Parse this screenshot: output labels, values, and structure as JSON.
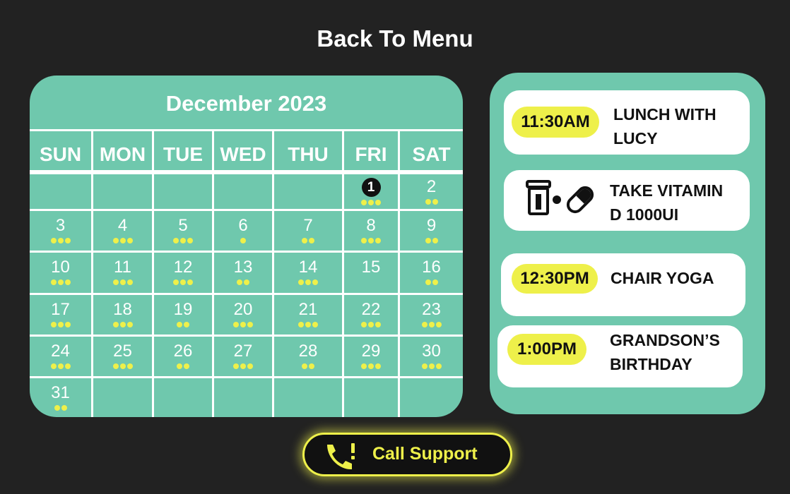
{
  "header": {
    "back_label": "Back To Menu"
  },
  "calendar": {
    "title": "December 2023",
    "weekdays": [
      "SUN",
      "MON",
      "TUE",
      "WED",
      "THU",
      "FRI",
      "SAT"
    ],
    "days": [
      {
        "n": "1",
        "dots": 3,
        "today": true
      },
      {
        "n": "2",
        "dots": 2
      },
      {
        "n": "3",
        "dots": 3
      },
      {
        "n": "4",
        "dots": 3
      },
      {
        "n": "5",
        "dots": 3
      },
      {
        "n": "6",
        "dots": 1
      },
      {
        "n": "7",
        "dots": 2
      },
      {
        "n": "8",
        "dots": 3
      },
      {
        "n": "9",
        "dots": 2
      },
      {
        "n": "10",
        "dots": 3
      },
      {
        "n": "11",
        "dots": 3
      },
      {
        "n": "12",
        "dots": 3
      },
      {
        "n": "13",
        "dots": 2
      },
      {
        "n": "14",
        "dots": 3
      },
      {
        "n": "15",
        "dots": 0
      },
      {
        "n": "16",
        "dots": 2
      },
      {
        "n": "17",
        "dots": 3
      },
      {
        "n": "18",
        "dots": 3
      },
      {
        "n": "19",
        "dots": 2
      },
      {
        "n": "20",
        "dots": 3
      },
      {
        "n": "21",
        "dots": 3
      },
      {
        "n": "22",
        "dots": 3
      },
      {
        "n": "23",
        "dots": 3
      },
      {
        "n": "24",
        "dots": 3
      },
      {
        "n": "25",
        "dots": 3
      },
      {
        "n": "26",
        "dots": 2
      },
      {
        "n": "27",
        "dots": 3
      },
      {
        "n": "28",
        "dots": 2
      },
      {
        "n": "29",
        "dots": 3
      },
      {
        "n": "30",
        "dots": 3
      },
      {
        "n": "31",
        "dots": 2
      }
    ]
  },
  "events": [
    {
      "time": "11:30AM",
      "title_line1": "LUNCH WITH",
      "title_line2": "LUCY"
    },
    {
      "icon": "pill-bottle-icon",
      "title_line1": "TAKE VITAMIN",
      "title_line2": "D 1000UI"
    },
    {
      "time": "12:30PM",
      "title_line1": "CHAIR YOGA",
      "title_line2": ""
    },
    {
      "time": "1:00PM",
      "title_line1": "GRANDSON’S",
      "title_line2": "BIRTHDAY"
    }
  ],
  "support": {
    "label": "Call Support",
    "icon": "phone-alert-icon"
  },
  "colors": {
    "background": "#222222",
    "panel": "#6fc8ad",
    "accent": "#eef04a",
    "text_dark": "#111111",
    "text_light": "#ffffff"
  }
}
